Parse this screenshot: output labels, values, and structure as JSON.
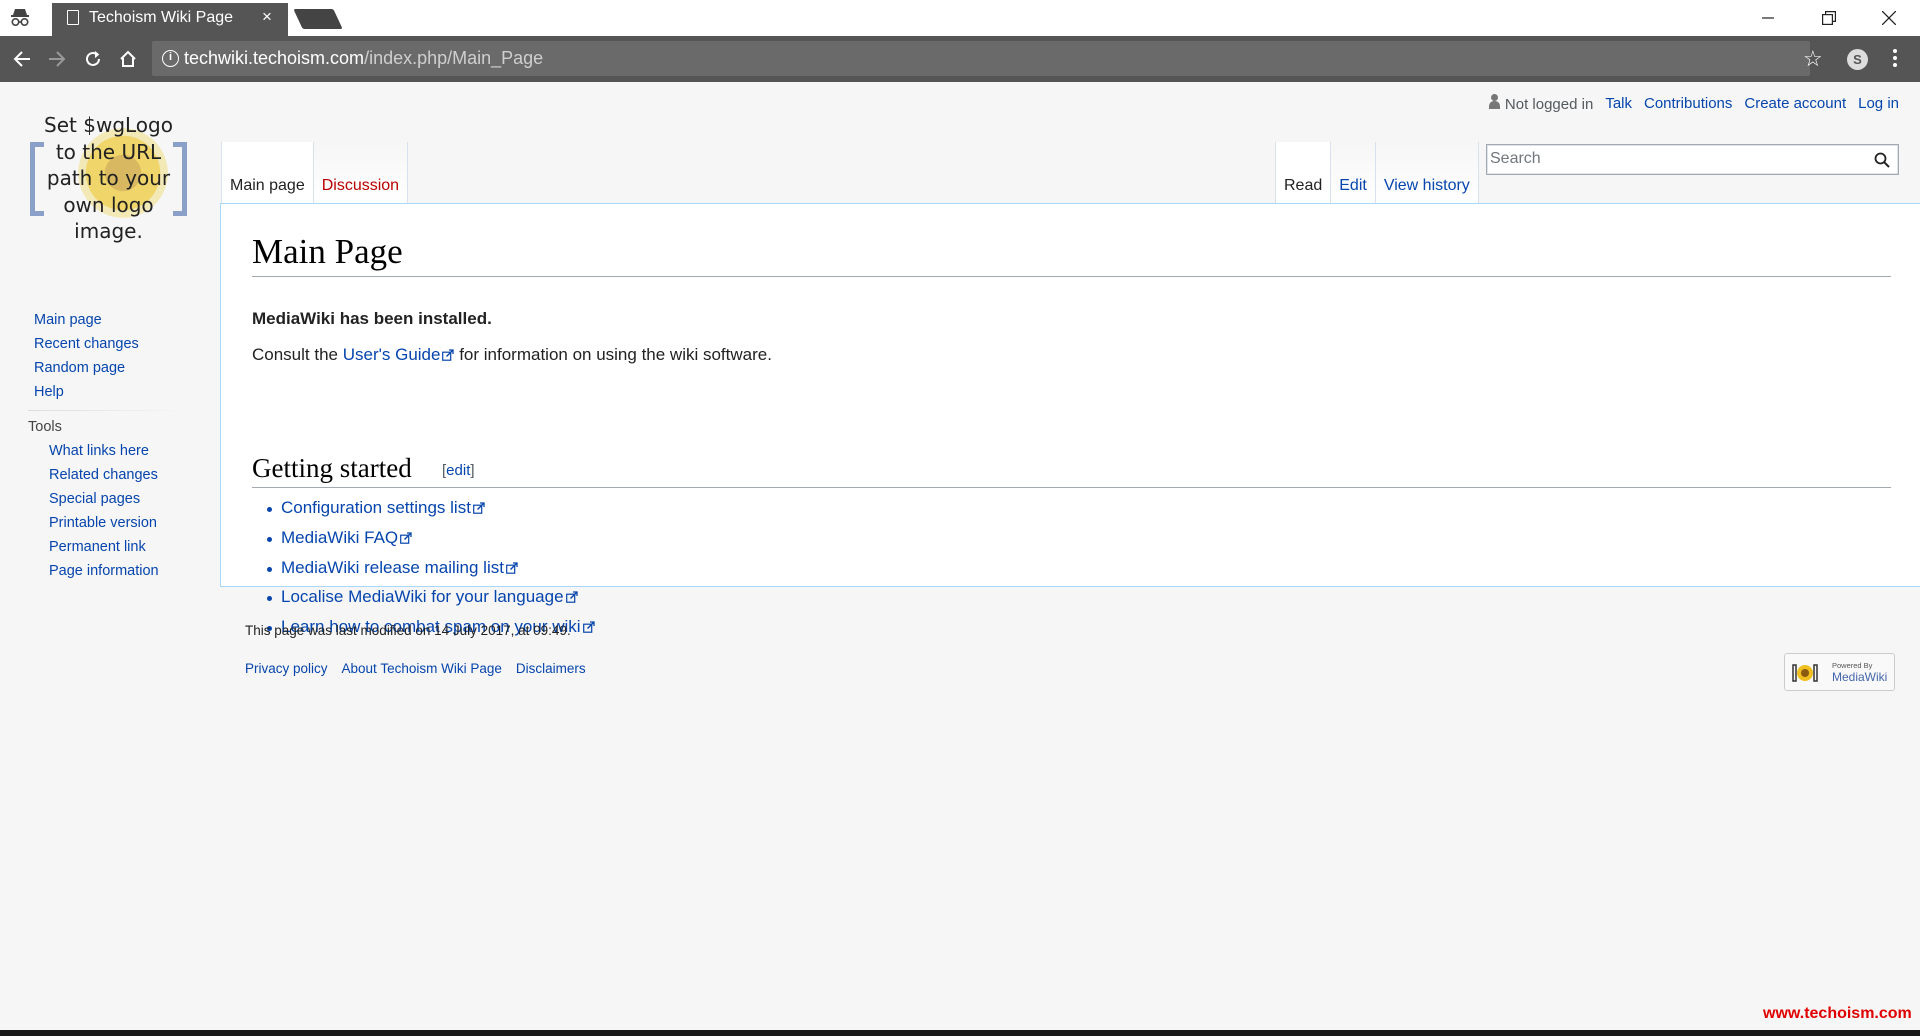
{
  "browser": {
    "tab_title": "Techoism Wiki Page",
    "tab_close": "×",
    "url_host": "techwiki.techoism.com",
    "url_path": "/index.php/Main_Page",
    "extension_letter": "S"
  },
  "personal": {
    "status": "Not logged in",
    "links": [
      "Talk",
      "Contributions",
      "Create account",
      "Log in"
    ]
  },
  "logo": {
    "lines": [
      "Set $wgLogo",
      "to the URL",
      "path to your",
      "own logo",
      "image."
    ]
  },
  "sidebar": {
    "nav": [
      "Main page",
      "Recent changes",
      "Random page",
      "Help"
    ],
    "tools_heading": "Tools",
    "tools": [
      "What links here",
      "Related changes",
      "Special pages",
      "Printable version",
      "Permanent link",
      "Page information"
    ]
  },
  "tabs": {
    "main_page": "Main page",
    "discussion": "Discussion",
    "read": "Read",
    "edit": "Edit",
    "view_history": "View history"
  },
  "search": {
    "placeholder": "Search"
  },
  "article": {
    "title": "Main Page",
    "installed": "MediaWiki has been installed.",
    "consult_prefix": "Consult the ",
    "users_guide": "User's Guide",
    "consult_suffix": " for information on using the wiki software.",
    "section_title": "Getting started",
    "section_edit_open": "[",
    "section_edit": "edit",
    "section_edit_close": "]",
    "links": [
      "Configuration settings list",
      "MediaWiki FAQ",
      "MediaWiki release mailing list",
      "Localise MediaWiki for your language",
      "Learn how to combat spam on your wiki"
    ]
  },
  "footer": {
    "last_modified": "This page was last modified on 14 July 2017, at 09:49.",
    "links": [
      "Privacy policy",
      "About Techoism Wiki Page",
      "Disclaimers"
    ],
    "powered_by": "Powered By",
    "powered_name": "MediaWiki"
  },
  "watermark": "www.techoism.com",
  "colors": {
    "link": "#0645ad",
    "new_link": "#ba0000",
    "chrome": "#555555",
    "watermark": "#e00000"
  }
}
